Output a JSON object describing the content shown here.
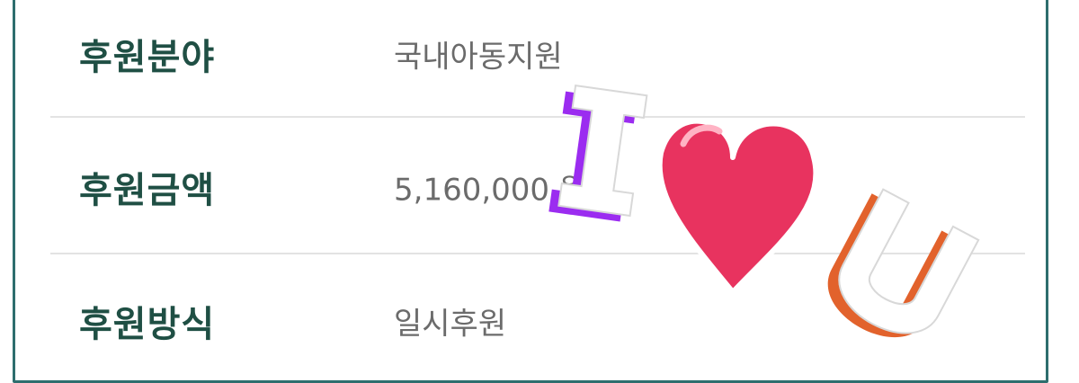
{
  "rows": [
    {
      "label": "후원분야",
      "value": "국내아동지원"
    },
    {
      "label": "후원금액",
      "value": "5,160,000 원"
    },
    {
      "label": "후원방식",
      "value": "일시후원"
    }
  ],
  "sticker": {
    "letter_left": "I",
    "letter_right": "U",
    "heart_color": "#e8335f",
    "letter_left_shadow": "#9b2cf0",
    "letter_right_shadow": "#e2622c"
  },
  "colors": {
    "frame": "#2e6e6e",
    "label": "#1f4f44",
    "value": "#6b6b6b",
    "divider": "#e3e3e3"
  }
}
